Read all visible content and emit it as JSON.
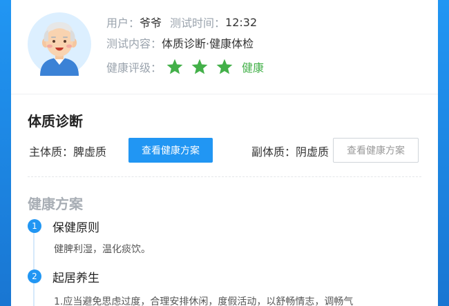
{
  "profile": {
    "user_label": "用户：",
    "user_value": "爷爷",
    "time_label": "测试时间：",
    "time_value": "12:32",
    "content_label": "测试内容：",
    "content_value": "体质诊断·健康体检",
    "rating_label": "健康评级：",
    "rating_stars": 3,
    "rating_text": "健康",
    "star_color": "#43b049"
  },
  "diagnosis": {
    "title": "体质诊断",
    "main_label": "主体质：",
    "main_value": "脾虚质",
    "main_button": "查看健康方案",
    "sub_label": "副体质：",
    "sub_value": "阴虚质",
    "sub_button": "查看健康方案"
  },
  "plan": {
    "title": "健康方案",
    "steps": [
      {
        "num": "1",
        "title": "保健原则",
        "text": "健脾利湿，温化痰饮。"
      },
      {
        "num": "2",
        "title": "起居养生",
        "text": "1.应当避免思虑过度，合理安排休闲，度假活动，以舒畅情志，调畅气"
      }
    ]
  },
  "colors": {
    "accent": "#2196f3",
    "green": "#43b049",
    "background": "#1e88e5"
  }
}
